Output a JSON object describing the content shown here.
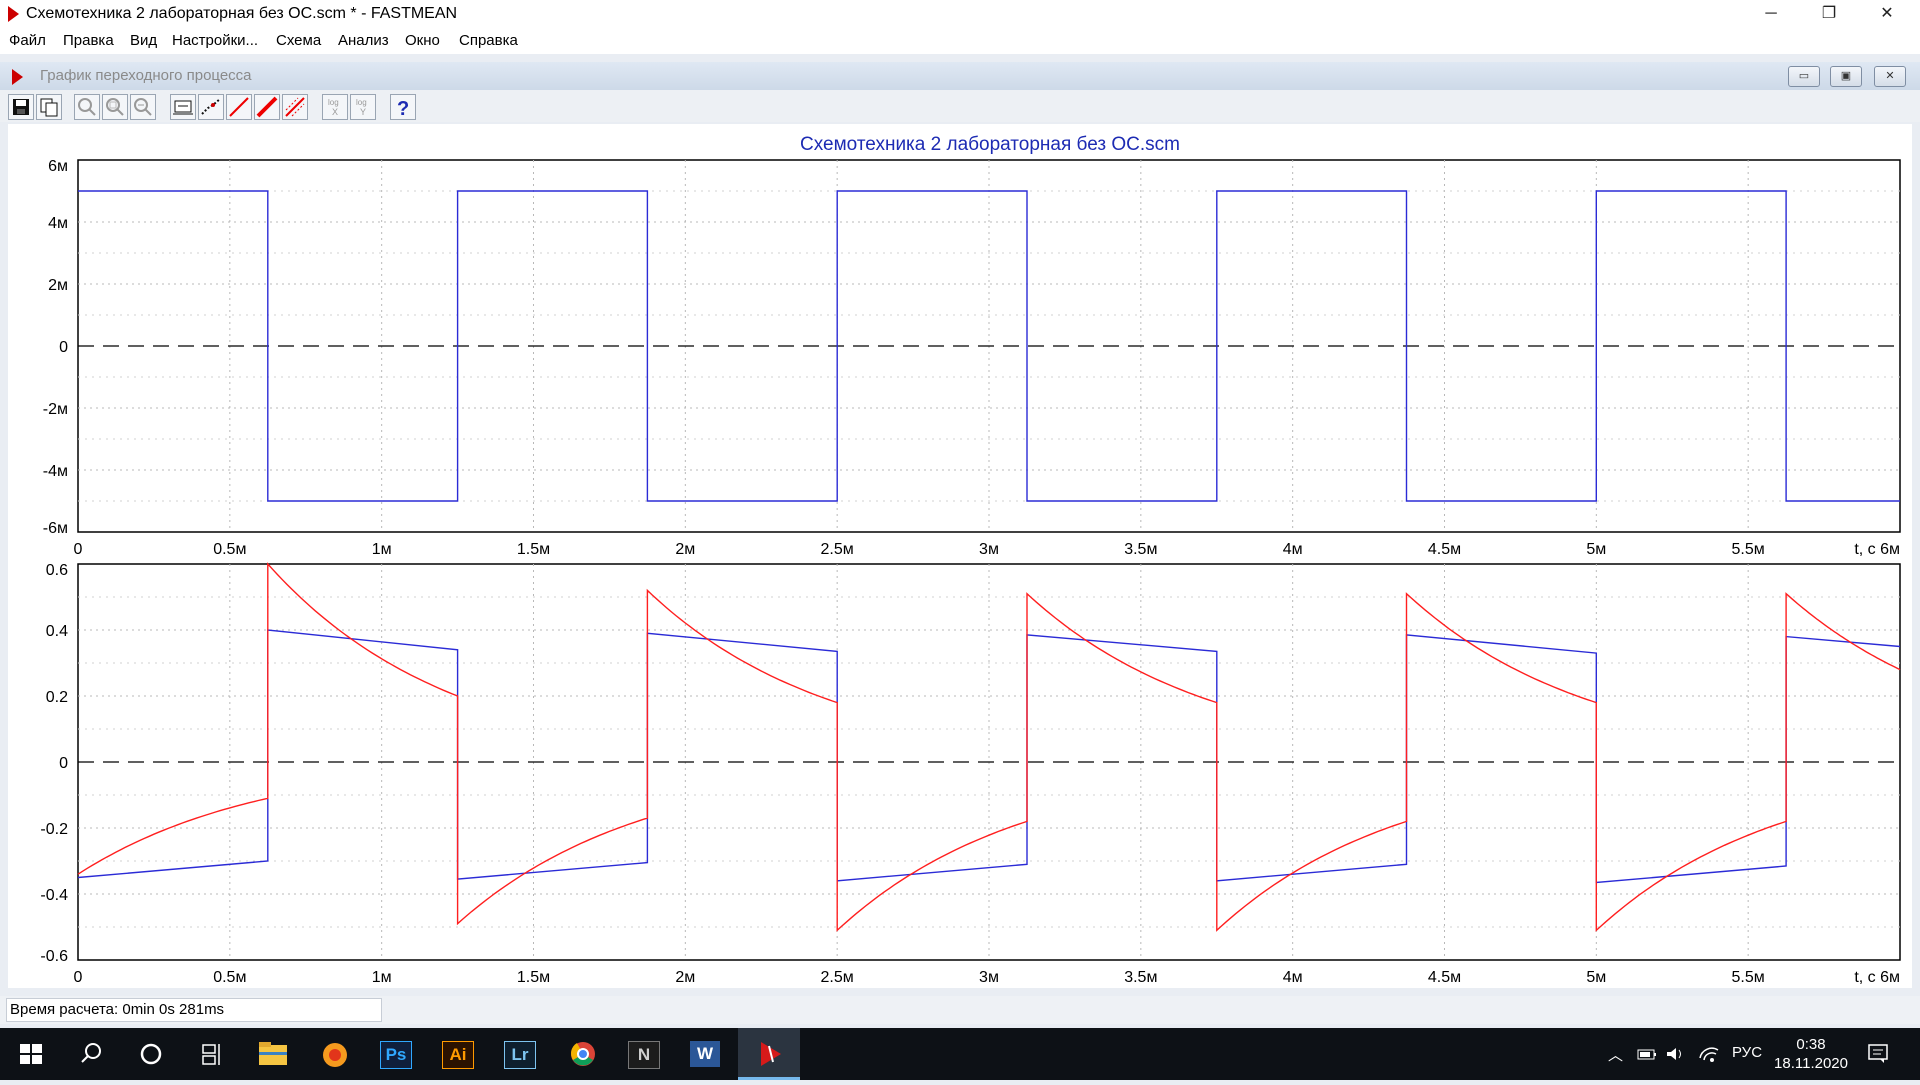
{
  "window": {
    "title": "Схемотехника 2 лабораторная без ОС.scm * - FASTMEAN",
    "controls": {
      "minimize": "─",
      "restore": "❐",
      "close": "✕"
    }
  },
  "menu": [
    "Файл",
    "Правка",
    "Вид",
    "Настройки...",
    "Схема",
    "Анализ",
    "Окно",
    "Справка"
  ],
  "inner_window": {
    "title": "График переходного процесса",
    "controls": {
      "minimize": "▭",
      "restore": "▣",
      "close": "✕"
    }
  },
  "toolbar": {
    "buttons": [
      {
        "name": "save-icon"
      },
      {
        "name": "copy-icon"
      },
      {
        "name": "zoom-icon"
      },
      {
        "name": "zoom-region-icon"
      },
      {
        "name": "zoom-out-icon"
      },
      {
        "name": "marker-icon"
      },
      {
        "name": "points-icon"
      },
      {
        "name": "line-icon"
      },
      {
        "name": "bold-line-icon"
      },
      {
        "name": "hatch-icon"
      },
      {
        "name": "log-x-icon"
      },
      {
        "name": "log-y-icon"
      },
      {
        "name": "help-icon"
      }
    ],
    "log_x": "log\nX",
    "log_y": "log\nY",
    "help": "?"
  },
  "chart_data": [
    {
      "type": "line",
      "title": "Схемотехника 2 лабораторная без ОС.scm",
      "xlabel": "t, с 6м",
      "xlim": [
        0,
        0.006
      ],
      "ylim": [
        -0.006,
        0.006
      ],
      "x_ticks": [
        "0",
        "0.5м",
        "1м",
        "1.5м",
        "2м",
        "2.5м",
        "3м",
        "3.5м",
        "4м",
        "4.5м",
        "5м",
        "5.5м"
      ],
      "y_ticks": [
        "6м",
        "4м",
        "2м",
        "0",
        "-2м",
        "-4м",
        "-6м"
      ],
      "zero_line": "dashed",
      "grid": "dotted",
      "series": [
        {
          "color": "#2b2bd6",
          "points": [
            [
              0,
              0.005
            ],
            [
              0.000625,
              0.005
            ],
            [
              0.000625,
              -0.005
            ],
            [
              0.00125,
              -0.005
            ],
            [
              0.00125,
              0.005
            ],
            [
              0.001875,
              0.005
            ],
            [
              0.001875,
              -0.005
            ],
            [
              0.0025,
              -0.005
            ],
            [
              0.0025,
              0.005
            ],
            [
              0.003125,
              0.005
            ],
            [
              0.003125,
              -0.005
            ],
            [
              0.00375,
              -0.005
            ],
            [
              0.00375,
              0.005
            ],
            [
              0.004375,
              0.005
            ],
            [
              0.004375,
              -0.005
            ],
            [
              0.005,
              -0.005
            ],
            [
              0.005,
              0.005
            ],
            [
              0.005625,
              0.005
            ],
            [
              0.005625,
              -0.005
            ],
            [
              0.006,
              -0.005
            ]
          ]
        }
      ]
    },
    {
      "type": "line",
      "xlabel": "t, с 6м",
      "xlim": [
        0,
        0.006
      ],
      "ylim": [
        -0.6,
        0.6
      ],
      "x_ticks": [
        "0",
        "0.5м",
        "1м",
        "1.5м",
        "2м",
        "2.5м",
        "3м",
        "3.5м",
        "4м",
        "4.5м",
        "5м",
        "5.5м"
      ],
      "y_ticks": [
        "0.6",
        "0.4",
        "0.2",
        "0",
        "-0.2",
        "-0.4",
        "-0.6"
      ],
      "zero_line": "dashed",
      "grid": "dotted",
      "series": [
        {
          "color": "#2b2bd6",
          "points": [
            [
              0,
              -0.35
            ],
            [
              0.000625,
              -0.3
            ],
            [
              0.000625,
              0.4
            ],
            [
              0.00125,
              0.34
            ],
            [
              0.00125,
              -0.355
            ],
            [
              0.001875,
              -0.305
            ],
            [
              0.001875,
              0.39
            ],
            [
              0.0025,
              0.335
            ],
            [
              0.0025,
              -0.36
            ],
            [
              0.003125,
              -0.31
            ],
            [
              0.003125,
              0.385
            ],
            [
              0.00375,
              0.335
            ],
            [
              0.00375,
              -0.36
            ],
            [
              0.004375,
              -0.31
            ],
            [
              0.004375,
              0.385
            ],
            [
              0.005,
              0.33
            ],
            [
              0.005,
              -0.365
            ],
            [
              0.005625,
              -0.315
            ],
            [
              0.005625,
              0.38
            ],
            [
              0.006,
              0.35
            ]
          ]
        },
        {
          "color": "#ff1f1f",
          "segments": [
            {
              "t0": 0,
              "t1": 0.000625,
              "v0": -0.34,
              "v1": -0.11,
              "shape": "exp-rise"
            },
            {
              "t0": 0.000625,
              "t1": 0.00125,
              "v0": 0.6,
              "v1": 0.2,
              "shape": "exp-decay"
            },
            {
              "t0": 0.00125,
              "t1": 0.001875,
              "v0": -0.49,
              "v1": -0.17,
              "shape": "exp-rise"
            },
            {
              "t0": 0.001875,
              "t1": 0.0025,
              "v0": 0.52,
              "v1": 0.18,
              "shape": "exp-decay"
            },
            {
              "t0": 0.0025,
              "t1": 0.003125,
              "v0": -0.51,
              "v1": -0.18,
              "shape": "exp-rise"
            },
            {
              "t0": 0.003125,
              "t1": 0.00375,
              "v0": 0.51,
              "v1": 0.18,
              "shape": "exp-decay"
            },
            {
              "t0": 0.00375,
              "t1": 0.004375,
              "v0": -0.51,
              "v1": -0.18,
              "shape": "exp-rise"
            },
            {
              "t0": 0.004375,
              "t1": 0.005,
              "v0": 0.51,
              "v1": 0.18,
              "shape": "exp-decay"
            },
            {
              "t0": 0.005,
              "t1": 0.005625,
              "v0": -0.51,
              "v1": -0.18,
              "shape": "exp-rise"
            },
            {
              "t0": 0.005625,
              "t1": 0.006,
              "v0": 0.51,
              "v1": 0.28,
              "shape": "exp-decay"
            }
          ]
        }
      ]
    }
  ],
  "status": {
    "calc_time": "Время расчета: 0min 0s 281ms"
  },
  "taskbar": {
    "apps": [
      {
        "name": "start-icon"
      },
      {
        "name": "search-icon"
      },
      {
        "name": "cortana-icon"
      },
      {
        "name": "task-view-icon"
      },
      {
        "name": "file-explorer-icon"
      },
      {
        "name": "app-orange-icon"
      },
      {
        "name": "photoshop-icon",
        "label": "Ps"
      },
      {
        "name": "illustrator-icon",
        "label": "Ai"
      },
      {
        "name": "lightroom-icon",
        "label": "Lr"
      },
      {
        "name": "chrome-icon"
      },
      {
        "name": "app-n-icon",
        "label": "N"
      },
      {
        "name": "word-icon",
        "label": "W"
      },
      {
        "name": "fastmean-icon"
      }
    ],
    "lang": "РУС",
    "time": "0:38",
    "date": "18.11.2020"
  }
}
